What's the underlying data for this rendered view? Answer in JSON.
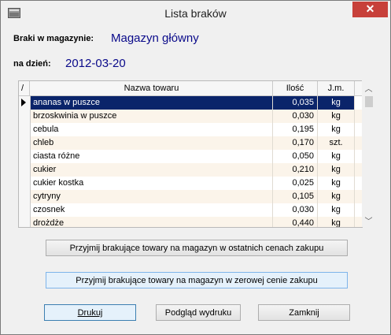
{
  "window": {
    "title": "Lista braków"
  },
  "header": {
    "warehouse_label": "Braki w magazynie:",
    "warehouse_value": "Magazyn główny",
    "date_label": "na dzień:",
    "date_value": "2012-03-20"
  },
  "grid": {
    "columns": [
      "Nazwa towaru",
      "Ilość",
      "J.m."
    ],
    "sort_mark": "/",
    "rows": [
      {
        "name": "ananas w puszce",
        "qty": "0,035",
        "unit": "kg"
      },
      {
        "name": "brzoskwinia w puszce",
        "qty": "0,030",
        "unit": "kg"
      },
      {
        "name": "cebula",
        "qty": "0,195",
        "unit": "kg"
      },
      {
        "name": "chleb",
        "qty": "0,170",
        "unit": "szt."
      },
      {
        "name": "ciasta różne",
        "qty": "0,050",
        "unit": "kg"
      },
      {
        "name": "cukier",
        "qty": "0,210",
        "unit": "kg"
      },
      {
        "name": "cukier kostka",
        "qty": "0,025",
        "unit": "kg"
      },
      {
        "name": "cytryny",
        "qty": "0,105",
        "unit": "kg"
      },
      {
        "name": "czosnek",
        "qty": "0,030",
        "unit": "kg"
      },
      {
        "name": "drożdże",
        "qty": "0,440",
        "unit": "kg"
      }
    ]
  },
  "buttons": {
    "accept_last": "Przyjmij brakujące towary na magazyn w ostatnich cenach zakupu",
    "accept_zero": "Przyjmij brakujące towary na magazyn w zerowej cenie zakupu",
    "print": "Drukuj",
    "preview": "Podgląd wydruku",
    "close": "Zamknij"
  }
}
